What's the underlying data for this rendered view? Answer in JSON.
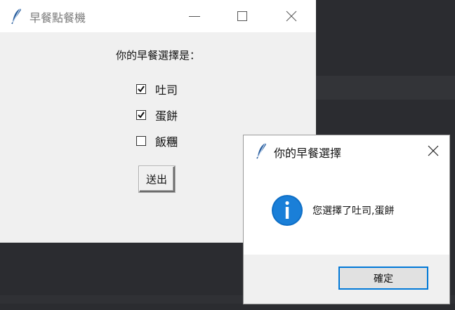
{
  "main_window": {
    "title": "早餐點餐機",
    "prompt": "你的早餐選擇是：",
    "options": [
      {
        "label": "吐司",
        "checked": true
      },
      {
        "label": "蛋餅",
        "checked": true
      },
      {
        "label": "飯糰",
        "checked": false
      }
    ],
    "submit_label": "送出"
  },
  "dialog": {
    "title": "你的早餐選擇",
    "message": "您選擇了吐司,蛋餅",
    "ok_label": "確定",
    "icon": "info-icon"
  },
  "colors": {
    "accent": "#0078d7",
    "desktop": "#2b2c30"
  }
}
